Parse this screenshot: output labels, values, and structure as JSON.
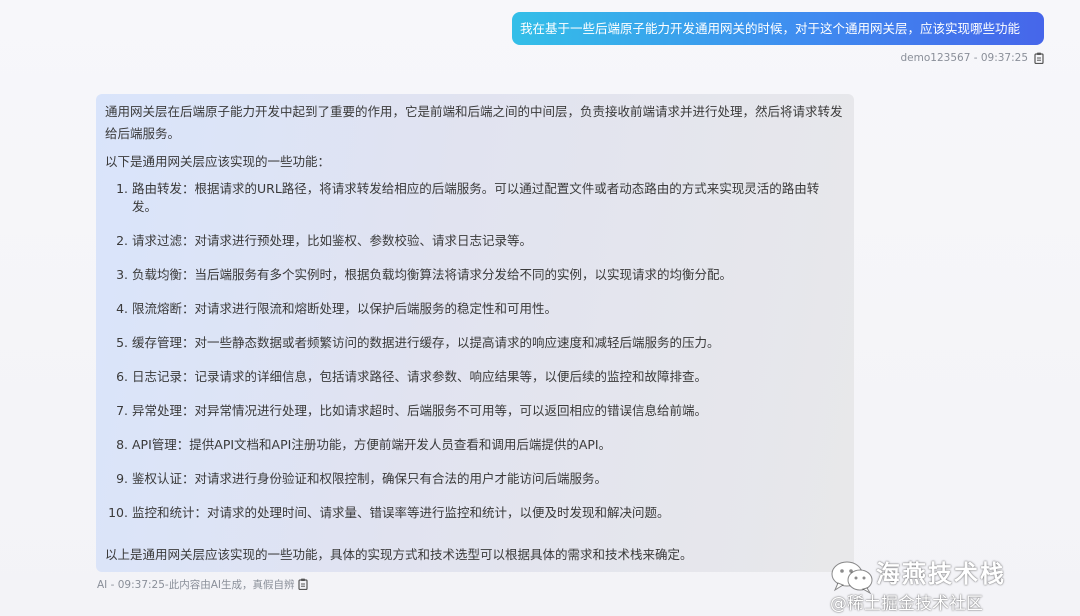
{
  "user_message": {
    "text": "我在基于一些后端原子能力开发通用网关的时候，对于这个通用网关层，应该实现哪些功能",
    "meta": "demo123567 - 09:37:25",
    "copy_icon": "clipboard-icon"
  },
  "ai_message": {
    "intro": "通用网关层在后端原子能力开发中起到了重要的作用，它是前端和后端之间的中间层，负责接收前端请求并进行处理，然后将请求转发给后端服务。",
    "lead": "以下是通用网关层应该实现的一些功能：",
    "items": [
      {
        "num": "1.",
        "text": "路由转发：根据请求的URL路径，将请求转发给相应的后端服务。可以通过配置文件或者动态路由的方式来实现灵活的路由转发。"
      },
      {
        "num": "2.",
        "text": "请求过滤：对请求进行预处理，比如鉴权、参数校验、请求日志记录等。"
      },
      {
        "num": "3.",
        "text": "负载均衡：当后端服务有多个实例时，根据负载均衡算法将请求分发给不同的实例，以实现请求的均衡分配。"
      },
      {
        "num": "4.",
        "text": "限流熔断：对请求进行限流和熔断处理，以保护后端服务的稳定性和可用性。"
      },
      {
        "num": "5.",
        "text": "缓存管理：对一些静态数据或者频繁访问的数据进行缓存，以提高请求的响应速度和减轻后端服务的压力。"
      },
      {
        "num": "6.",
        "text": "日志记录：记录请求的详细信息，包括请求路径、请求参数、响应结果等，以便后续的监控和故障排查。"
      },
      {
        "num": "7.",
        "text": "异常处理：对异常情况进行处理，比如请求超时、后端服务不可用等，可以返回相应的错误信息给前端。"
      },
      {
        "num": "8.",
        "text": "API管理：提供API文档和API注册功能，方便前端开发人员查看和调用后端提供的API。"
      },
      {
        "num": "9.",
        "text": "鉴权认证：对请求进行身份验证和权限控制，确保只有合法的用户才能访问后端服务。"
      },
      {
        "num": "10.",
        "text": "监控和统计：对请求的处理时间、请求量、错误率等进行监控和统计，以便及时发现和解决问题。"
      }
    ],
    "outro": "以上是通用网关层应该实现的一些功能，具体的实现方式和技术选型可以根据具体的需求和技术栈来确定。",
    "meta": "AI - 09:37:25-此内容由AI生成，真假自辨",
    "copy_icon": "clipboard-icon"
  },
  "watermark": {
    "title": "海燕技术栈",
    "subtitle": "@稀土掘金技术社区",
    "logo_icon": "wechat-icon"
  }
}
